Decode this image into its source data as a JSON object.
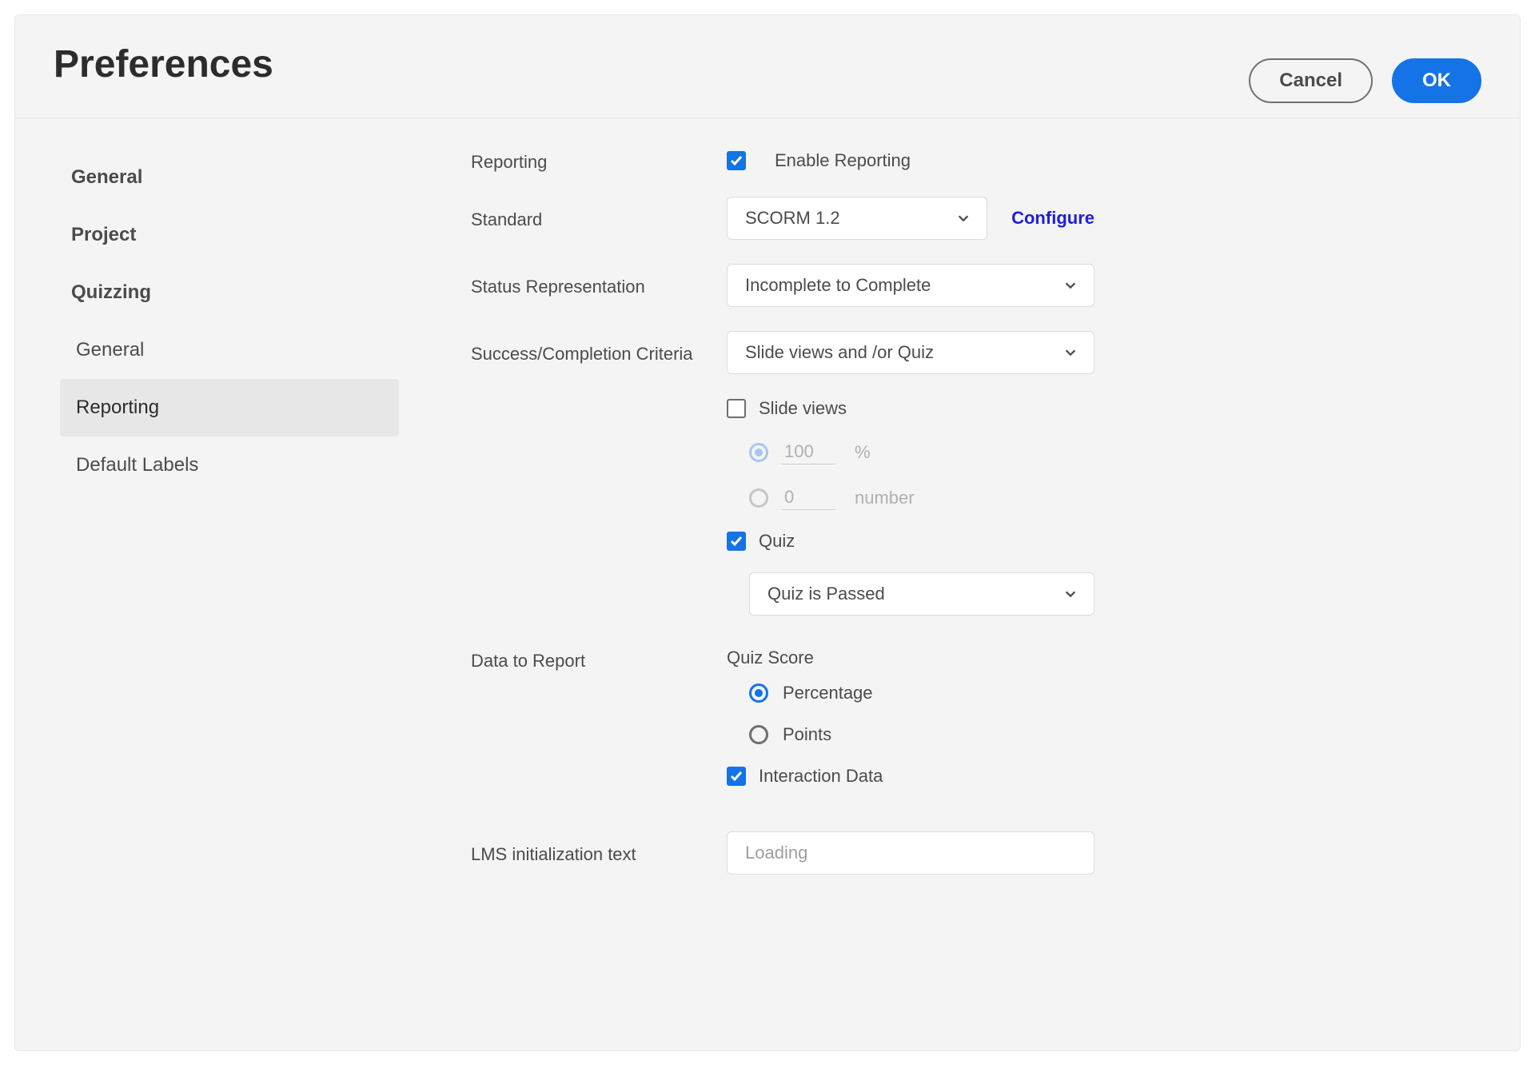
{
  "header": {
    "title": "Preferences",
    "cancel": "Cancel",
    "ok": "OK"
  },
  "sidebar": {
    "items": {
      "general": "General",
      "project": "Project",
      "quizzing": "Quizzing",
      "quiz_general": "General",
      "quiz_reporting": "Reporting",
      "quiz_labels": "Default Labels"
    }
  },
  "form": {
    "reporting_label": "Reporting",
    "enable_reporting": "Enable Reporting",
    "standard_label": "Standard",
    "standard_value": "SCORM 1.2",
    "configure": "Configure",
    "status_label": "Status Representation",
    "status_value": "Incomplete to Complete",
    "criteria_label": "Success/Completion Criteria",
    "criteria_value": "Slide views and /or Quiz",
    "slide_views": "Slide views",
    "slide_percent_value": "100",
    "slide_percent_unit": "%",
    "slide_number_value": "0",
    "slide_number_unit": "number",
    "quiz_label": "Quiz",
    "quiz_value": "Quiz is Passed",
    "data_report_label": "Data to Report",
    "quiz_score_label": "Quiz Score",
    "percentage": "Percentage",
    "points": "Points",
    "interaction_data": "Interaction Data",
    "lms_init_label": "LMS initialization text",
    "lms_init_value": "Loading"
  }
}
